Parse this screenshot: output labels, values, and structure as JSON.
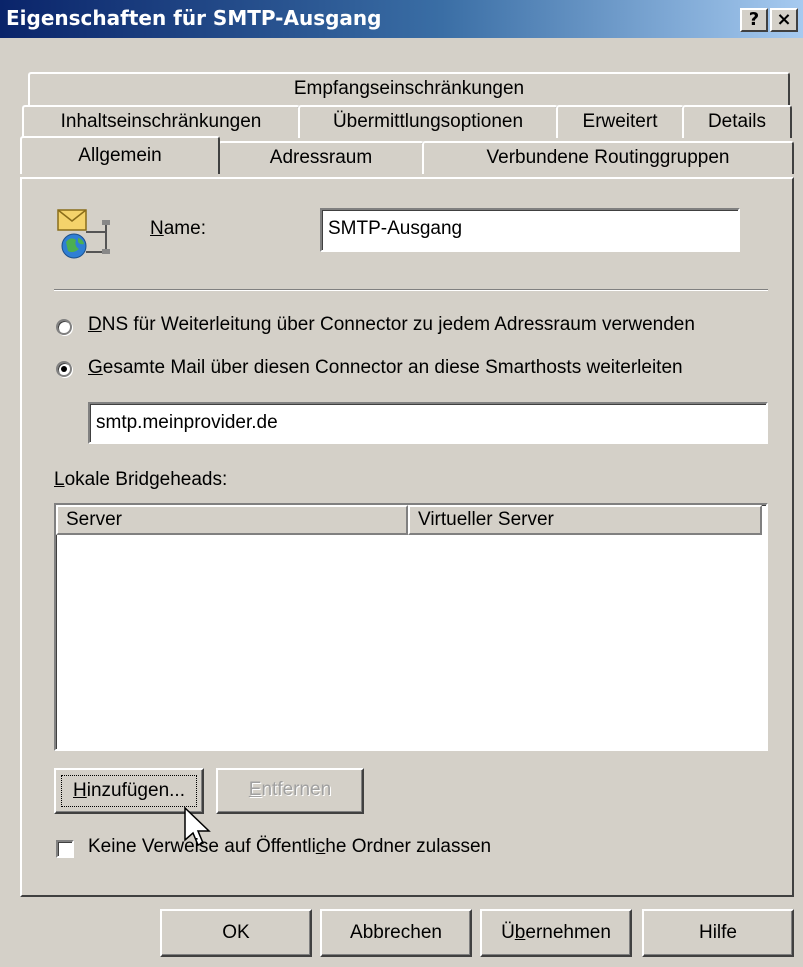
{
  "window": {
    "title": "Eigenschaften für SMTP-Ausgang",
    "help_button": "?",
    "close_button": "×"
  },
  "tabs": {
    "row1": [
      {
        "label": "Empfangseinschränkungen"
      }
    ],
    "row2": [
      {
        "label": "Inhaltseinschränkungen"
      },
      {
        "label": "Übermittlungsoptionen"
      },
      {
        "label": "Erweitert"
      },
      {
        "label": "Details"
      }
    ],
    "row3": [
      {
        "label": "Allgemein",
        "selected": true
      },
      {
        "label": "Adressraum"
      },
      {
        "label": "Verbundene Routinggruppen"
      }
    ]
  },
  "general": {
    "name_label_accel": "N",
    "name_label_rest": "ame:",
    "name_value": "SMTP-Ausgang",
    "radio_dns": {
      "accel": "D",
      "rest": "NS für Weiterleitung über Connector zu jedem Adressraum verwenden",
      "checked": false
    },
    "radio_smarthost": {
      "accel": "G",
      "rest": "esamte Mail über diesen Connector an diese Smarthosts weiterleiten",
      "checked": true
    },
    "smarthost_value": "smtp.meinprovider.de",
    "bridgeheads_label_accel": "L",
    "bridgeheads_label_rest": "okale Bridgeheads:",
    "columns": [
      "Server",
      "Virtueller Server"
    ],
    "rows": [],
    "add_button_accel": "H",
    "add_button_rest": "inzufügen...",
    "remove_button_accel": "E",
    "remove_button_rest": "ntfernen",
    "no_public_folder_referrals": {
      "label_before": "Keine Verweise auf Öffentli",
      "accel": "c",
      "label_after": "he Ordner zulassen",
      "checked": false
    }
  },
  "footer": {
    "ok": "OK",
    "cancel": "Abbrechen",
    "apply_before": "Ü",
    "apply_accel": "b",
    "apply_after": "ernehmen",
    "help": "Hilfe"
  },
  "icons": {
    "connector": "mail-connector-icon",
    "cursor": "mouse-pointer-icon"
  }
}
